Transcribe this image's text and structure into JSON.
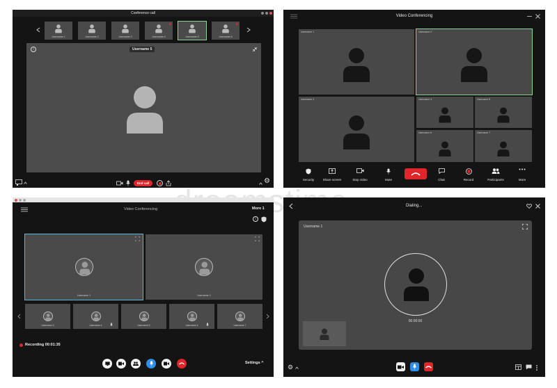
{
  "w1": {
    "title": "Conference call",
    "thumbs": [
      "Username 1",
      "Username 2",
      "Username 3",
      "Username 4",
      "Username 5",
      "Username 6"
    ],
    "main_user": "Username 5",
    "end_label": "End call"
  },
  "w2": {
    "title": "Video Conferencing",
    "tiles": [
      "Username 1",
      "Username 2",
      "Username 3",
      "Username 4",
      "Username 5",
      "Username 6",
      "Username 7"
    ],
    "toolbar": [
      "Security",
      "Share screen",
      "Stop video",
      "Mute",
      "",
      "Chat",
      "Record",
      "Participants",
      "More"
    ]
  },
  "w3": {
    "title": "Video Conferencing",
    "more_label": "More",
    "more_count": "1",
    "big": [
      "Username 1",
      "Username 2"
    ],
    "small": [
      "Username 3",
      "Username 4",
      "Username 5",
      "Username 6",
      "Username 7"
    ],
    "recording": "Recording 00:01:35",
    "settings": "Settings"
  },
  "w4": {
    "title": "Dialing...",
    "user": "Username 1",
    "timer": "00:00:00"
  },
  "watermark": "dreamstime",
  "colors": {
    "active": "#8fd694",
    "selected": "#5bb7e0",
    "end": "#e0252b",
    "mic": "#2f8ee8"
  }
}
